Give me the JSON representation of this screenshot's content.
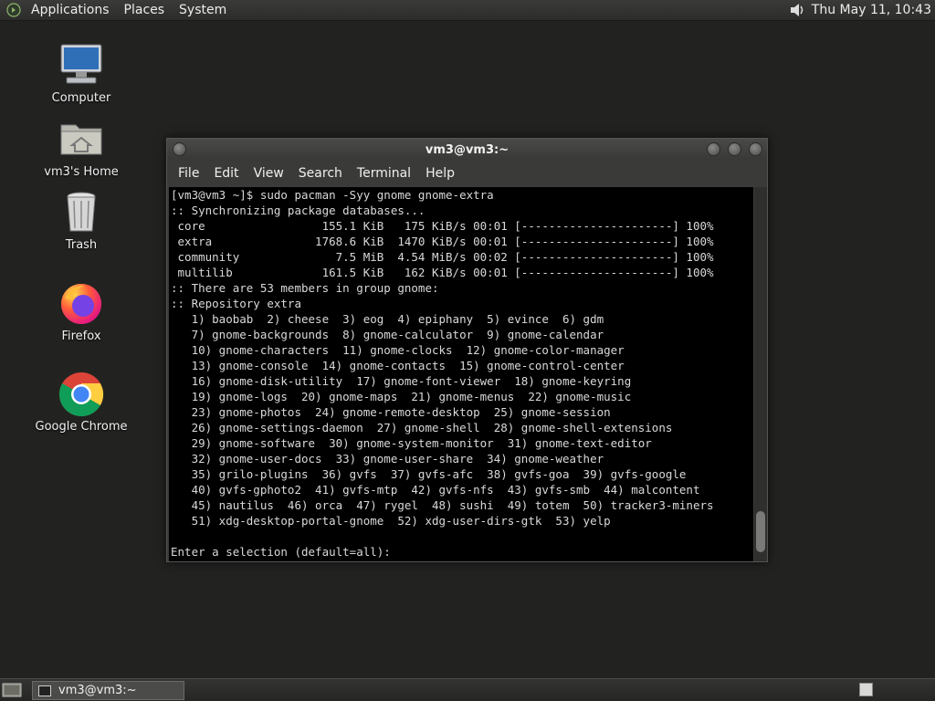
{
  "top_panel": {
    "menus": [
      "Applications",
      "Places",
      "System"
    ],
    "clock": "Thu May 11, 10:43"
  },
  "desktop_icons": [
    {
      "label": "Computer",
      "icon": "computer-icon"
    },
    {
      "label": "vm3's Home",
      "icon": "home-folder-icon"
    },
    {
      "label": "Trash",
      "icon": "trash-icon"
    },
    {
      "label": "Firefox",
      "icon": "firefox-icon"
    },
    {
      "label": "Google Chrome",
      "icon": "chrome-icon"
    }
  ],
  "terminal": {
    "title": "vm3@vm3:~",
    "menus": [
      "File",
      "Edit",
      "View",
      "Search",
      "Terminal",
      "Help"
    ],
    "lines": [
      "[vm3@vm3 ~]$ sudo pacman -Syy gnome gnome-extra",
      ":: Synchronizing package databases...",
      " core                 155.1 KiB   175 KiB/s 00:01 [----------------------] 100%",
      " extra               1768.6 KiB  1470 KiB/s 00:01 [----------------------] 100%",
      " community              7.5 MiB  4.54 MiB/s 00:02 [----------------------] 100%",
      " multilib             161.5 KiB   162 KiB/s 00:01 [----------------------] 100%",
      ":: There are 53 members in group gnome:",
      ":: Repository extra",
      "   1) baobab  2) cheese  3) eog  4) epiphany  5) evince  6) gdm",
      "   7) gnome-backgrounds  8) gnome-calculator  9) gnome-calendar",
      "   10) gnome-characters  11) gnome-clocks  12) gnome-color-manager",
      "   13) gnome-console  14) gnome-contacts  15) gnome-control-center",
      "   16) gnome-disk-utility  17) gnome-font-viewer  18) gnome-keyring",
      "   19) gnome-logs  20) gnome-maps  21) gnome-menus  22) gnome-music",
      "   23) gnome-photos  24) gnome-remote-desktop  25) gnome-session",
      "   26) gnome-settings-daemon  27) gnome-shell  28) gnome-shell-extensions",
      "   29) gnome-software  30) gnome-system-monitor  31) gnome-text-editor",
      "   32) gnome-user-docs  33) gnome-user-share  34) gnome-weather",
      "   35) grilo-plugins  36) gvfs  37) gvfs-afc  38) gvfs-goa  39) gvfs-google",
      "   40) gvfs-gphoto2  41) gvfs-mtp  42) gvfs-nfs  43) gvfs-smb  44) malcontent",
      "   45) nautilus  46) orca  47) rygel  48) sushi  49) totem  50) tracker3-miners",
      "   51) xdg-desktop-portal-gnome  52) xdg-user-dirs-gtk  53) yelp",
      "",
      "Enter a selection (default=all): "
    ]
  },
  "taskbar": {
    "task_label": "vm3@vm3:~"
  }
}
